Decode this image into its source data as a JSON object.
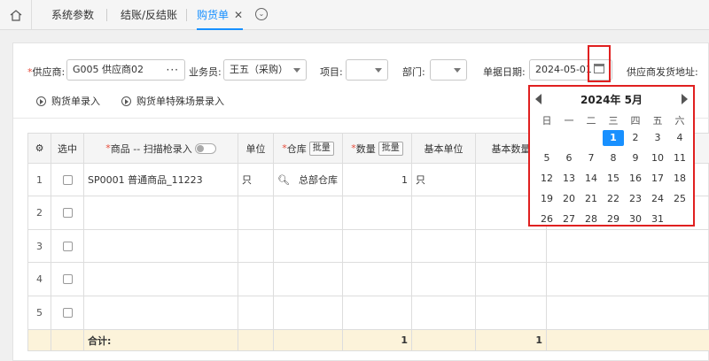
{
  "tabs": [
    {
      "label": "系统参数",
      "active": false
    },
    {
      "label": "结账/反结账",
      "active": false
    },
    {
      "label": "购货单",
      "active": true
    }
  ],
  "form": {
    "supplier_label": "供应商:",
    "supplier_value": "G005 供应商02",
    "salesman_label": "业务员:",
    "salesman_value": "王五（采购）",
    "project_label": "项目:",
    "dept_label": "部门:",
    "date_label": "单据日期:",
    "date_value": "2024-05-01",
    "address_label": "供应商发货地址:"
  },
  "actions": [
    {
      "label": "购货单录入"
    },
    {
      "label": "购货单特殊场景录入"
    }
  ],
  "grid": {
    "headers": {
      "select": "选中",
      "product": "商品 -- 扫描枪录入",
      "unit": "单位",
      "warehouse": "仓库",
      "warehouse_batch": "批量",
      "qty": "数量",
      "qty_batch": "批量",
      "base_unit": "基本单位",
      "base_qty": "基本数量"
    },
    "rows": [
      {
        "num": "1",
        "product": "SP0001 普通商品_11223",
        "unit": "只",
        "warehouse": "总部仓库",
        "qty": "1",
        "base_unit": "只"
      },
      {
        "num": "2",
        "product": "",
        "unit": "",
        "warehouse": "",
        "qty": "",
        "base_unit": ""
      },
      {
        "num": "3",
        "product": "",
        "unit": "",
        "warehouse": "",
        "qty": "",
        "base_unit": ""
      },
      {
        "num": "4",
        "product": "",
        "unit": "",
        "warehouse": "",
        "qty": "",
        "base_unit": ""
      },
      {
        "num": "5",
        "product": "",
        "unit": "",
        "warehouse": "",
        "qty": "",
        "base_unit": ""
      }
    ],
    "total_label": "合计:",
    "total_qty": "1",
    "total_base_qty": "1"
  },
  "calendar": {
    "title": "2024年  5月",
    "weekdays": [
      "日",
      "一",
      "二",
      "三",
      "四",
      "五",
      "六"
    ],
    "days": [
      "1",
      "2",
      "3",
      "4",
      "5",
      "6",
      "7",
      "8",
      "9",
      "10",
      "11",
      "12",
      "13",
      "14",
      "15",
      "16",
      "17",
      "18",
      "19",
      "20",
      "21",
      "22",
      "23",
      "24",
      "25",
      "26",
      "27",
      "28",
      "29",
      "30",
      "31"
    ],
    "selected": "1"
  },
  "colors": {
    "accent": "#1890ff",
    "highlight": "#e02020",
    "total_bg": "#fcf3da"
  }
}
